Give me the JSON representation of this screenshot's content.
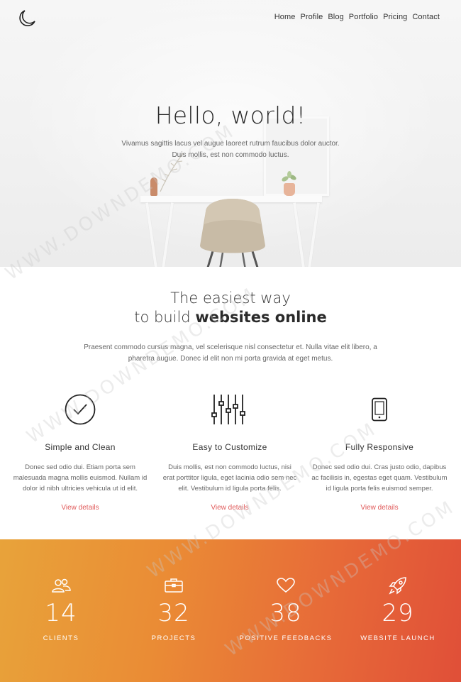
{
  "nav": {
    "items": [
      "Home",
      "Profile",
      "Blog",
      "Portfolio",
      "Pricing",
      "Contact"
    ]
  },
  "hero": {
    "title": "Hello, world!",
    "subtitle_line1": "Vivamus sagittis lacus vel augue laoreet rutrum faucibus dolor auctor.",
    "subtitle_line2": "Duis mollis, est non commodo luctus."
  },
  "intro": {
    "title_line1": "The easiest way",
    "title_line2_prefix": "to build ",
    "title_line2_bold": "websites online",
    "description": "Praesent commodo cursus magna, vel scelerisque nisl consectetur et. Nulla vitae elit libero, a pharetra augue. Donec id elit non mi porta gravida at eget metus."
  },
  "features": [
    {
      "icon": "check-circle-icon",
      "title": "Simple and Clean",
      "text": "Donec sed odio dui. Etiam porta sem malesuada magna mollis euismod. Nullam id dolor id nibh ultricies vehicula ut id elit.",
      "link": "View details"
    },
    {
      "icon": "sliders-icon",
      "title": "Easy to Customize",
      "text": "Duis mollis, est non commodo luctus, nisi erat porttitor ligula, eget lacinia odio sem nec elit. Vestibulum id ligula porta felis.",
      "link": "View details"
    },
    {
      "icon": "smartphone-icon",
      "title": "Fully Responsive",
      "text": "Donec sed odio dui. Cras justo odio, dapibus ac facilisis in, egestas eget quam. Vestibulum id ligula porta felis euismod semper.",
      "link": "View details"
    }
  ],
  "stats": [
    {
      "icon": "users-icon",
      "number": "14",
      "label": "CLIENTS"
    },
    {
      "icon": "briefcase-icon",
      "number": "32",
      "label": "PROJECTS"
    },
    {
      "icon": "heart-icon",
      "number": "38",
      "label": "POSITIVE FEEDBACKS"
    },
    {
      "icon": "rocket-icon",
      "number": "29",
      "label": "WEBSITE LAUNCH"
    }
  ],
  "watermark": "WWW.DOWNDEMO.COM",
  "colors": {
    "accent_link": "#e05a5a",
    "stats_gradient_start": "#e8a33a",
    "stats_gradient_end": "#e04f38"
  }
}
